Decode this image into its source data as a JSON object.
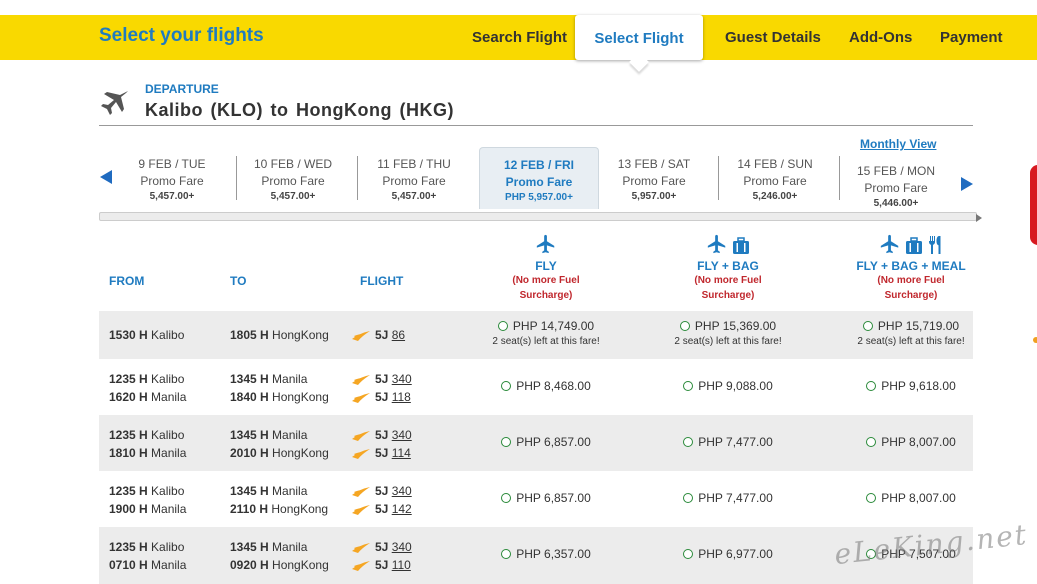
{
  "header": {
    "title": "Select your flights",
    "steps": [
      "Search Flight",
      "Select Flight",
      "Guest Details",
      "Add-Ons",
      "Payment"
    ],
    "active_step": "Select Flight"
  },
  "route": {
    "label": "DEPARTURE",
    "text": "Kalibo (KLO) to HongKong (HKG)"
  },
  "monthly_view": "Monthly View",
  "dates": [
    {
      "day": "9 FEB / TUE",
      "fare_type": "Promo Fare",
      "price": "5,457.00+"
    },
    {
      "day": "10 FEB / WED",
      "fare_type": "Promo Fare",
      "price": "5,457.00+"
    },
    {
      "day": "11 FEB / THU",
      "fare_type": "Promo Fare",
      "price": "5,457.00+"
    },
    {
      "day": "12 FEB / FRI",
      "fare_type": "Promo Fare",
      "price": "PHP 5,957.00+"
    },
    {
      "day": "13 FEB / SAT",
      "fare_type": "Promo Fare",
      "price": "5,957.00+"
    },
    {
      "day": "14 FEB / SUN",
      "fare_type": "Promo Fare",
      "price": "5,246.00+"
    },
    {
      "day": "15 FEB / MON",
      "fare_type": "Promo Fare",
      "price": "5,446.00+"
    }
  ],
  "table": {
    "col_from": "FROM",
    "col_to": "TO",
    "col_flight": "FLIGHT",
    "fare_types": [
      {
        "name": "FLY",
        "note1": "(No more Fuel",
        "note2": "Surcharge)"
      },
      {
        "name": "FLY + BAG",
        "note1": "(No more Fuel",
        "note2": "Surcharge)"
      },
      {
        "name": "FLY + BAG + MEAL",
        "note1": "(No more Fuel",
        "note2": "Surcharge)"
      }
    ],
    "rows": [
      {
        "segments": [
          {
            "dep_time": "1530 H",
            "dep_city": "Kalibo",
            "arr_time": "1805 H",
            "arr_city": "HongKong",
            "code": "5J",
            "number": "86"
          }
        ],
        "fares": [
          "PHP 14,749.00",
          "PHP 15,369.00",
          "PHP 15,719.00"
        ],
        "seats_left": "2 seat(s) left at this fare!"
      },
      {
        "segments": [
          {
            "dep_time": "1235 H",
            "dep_city": "Kalibo",
            "arr_time": "1345 H",
            "arr_city": "Manila",
            "code": "5J",
            "number": "340"
          },
          {
            "dep_time": "1620 H",
            "dep_city": "Manila",
            "arr_time": "1840 H",
            "arr_city": "HongKong",
            "code": "5J",
            "number": "118"
          }
        ],
        "fares": [
          "PHP 8,468.00",
          "PHP 9,088.00",
          "PHP 9,618.00"
        ]
      },
      {
        "segments": [
          {
            "dep_time": "1235 H",
            "dep_city": "Kalibo",
            "arr_time": "1345 H",
            "arr_city": "Manila",
            "code": "5J",
            "number": "340"
          },
          {
            "dep_time": "1810 H",
            "dep_city": "Manila",
            "arr_time": "2010 H",
            "arr_city": "HongKong",
            "code": "5J",
            "number": "114"
          }
        ],
        "fares": [
          "PHP 6,857.00",
          "PHP 7,477.00",
          "PHP 8,007.00"
        ]
      },
      {
        "segments": [
          {
            "dep_time": "1235 H",
            "dep_city": "Kalibo",
            "arr_time": "1345 H",
            "arr_city": "Manila",
            "code": "5J",
            "number": "340"
          },
          {
            "dep_time": "1900 H",
            "dep_city": "Manila",
            "arr_time": "2110 H",
            "arr_city": "HongKong",
            "code": "5J",
            "number": "142"
          }
        ],
        "fares": [
          "PHP 6,857.00",
          "PHP 7,477.00",
          "PHP 8,007.00"
        ]
      },
      {
        "segments": [
          {
            "dep_time": "1235 H",
            "dep_city": "Kalibo",
            "arr_time": "1345 H",
            "arr_city": "Manila",
            "code": "5J",
            "number": "340"
          },
          {
            "dep_time": "0710 H",
            "dep_city": "Manila",
            "arr_time": "0920 H",
            "arr_city": "HongKong",
            "code": "5J",
            "number": "110"
          }
        ],
        "fares": [
          "PHP 6,357.00",
          "PHP 6,977.00",
          "PHP 7,507.00"
        ]
      }
    ]
  },
  "watermark": "eLeKing.net",
  "colors": {
    "brand_yellow": "#f9d900",
    "accent_blue": "#1f7bc0",
    "alert_red": "#c0272d"
  }
}
